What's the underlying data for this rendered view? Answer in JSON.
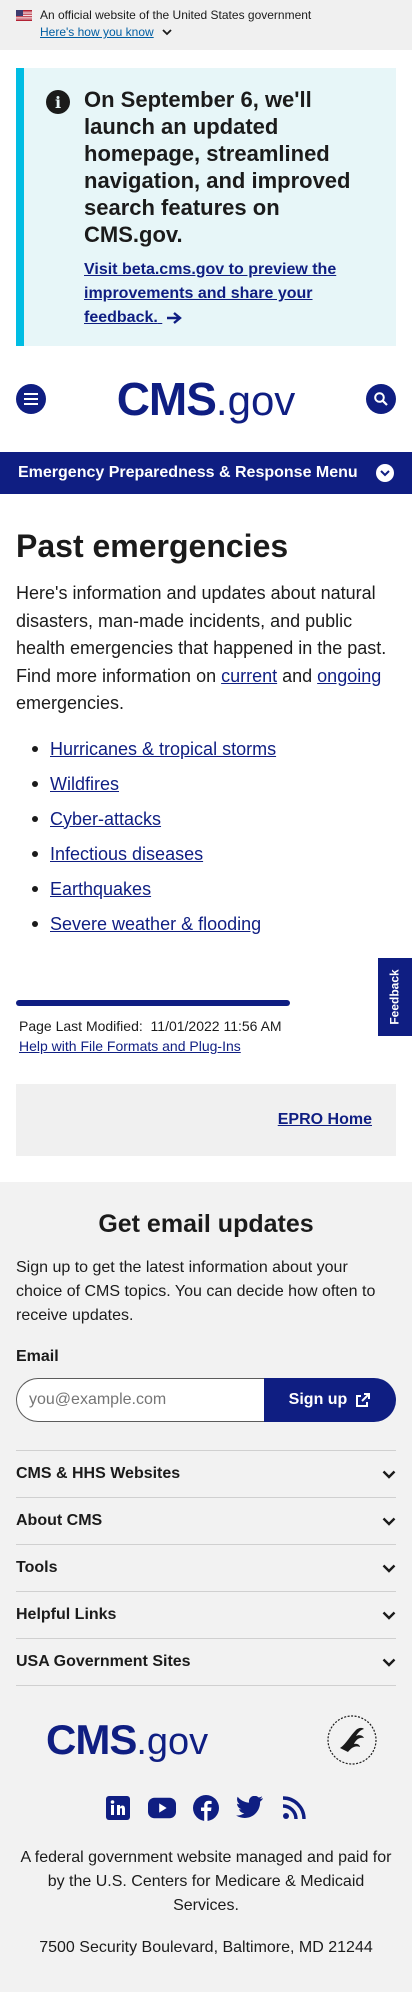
{
  "gov_banner": {
    "text": "An official website of the United States government",
    "link": "Here's how you know"
  },
  "alert": {
    "heading": "On September 6, we'll launch an updated homepage, streamlined navigation, and improved search features on CMS.gov.",
    "link_text": "Visit beta.cms.gov to preview the improvements and share your feedback."
  },
  "header": {
    "logo_bold": "CMS",
    "logo_rest": ".gov"
  },
  "menu": {
    "label": "Emergency Preparedness & Response Menu"
  },
  "main": {
    "title": "Past emergencies",
    "intro_prefix": "Here's information and updates about natural disasters, man-made incidents, and public health emergencies that happened in the past. Find more information on ",
    "intro_link1": "current",
    "intro_mid": " and ",
    "intro_link2": "ongoing",
    "intro_suffix": " emergencies.",
    "list": [
      "Hurricanes & tropical storms",
      "Wildfires",
      "Cyber-attacks",
      "Infectious diseases",
      "Earthquakes",
      "Severe weather & flooding"
    ]
  },
  "feedback": {
    "label": "Feedback"
  },
  "page_meta": {
    "modified_label": "Page Last Modified:",
    "modified_value": "11/01/2022 11:56 AM",
    "help_link": "Help with File Formats and Plug-Ins"
  },
  "epro": {
    "link": "EPRO Home"
  },
  "footer": {
    "signup_title": "Get email updates",
    "signup_desc": "Sign up to get the latest information about your choice of CMS topics. You can decide how often to receive updates.",
    "email_label": "Email",
    "email_placeholder": "you@example.com",
    "signup_button": "Sign up",
    "accordion": [
      "CMS & HHS Websites",
      "About CMS",
      "Tools",
      "Helpful Links",
      "USA Government Sites"
    ],
    "agency_text": "A federal government website managed and paid for by the U.S. Centers for Medicare & Medicaid Services.",
    "address": "7500 Security Boulevard, Baltimore, MD 21244"
  },
  "colors": {
    "primary": "#0f1e82",
    "alert_bg": "#e7f6f8",
    "alert_border": "#00bde3",
    "footer_bg": "#f2f2f2"
  },
  "icons": [
    "us-flag-icon",
    "chevron-down-icon",
    "info-icon",
    "arrow-right-icon",
    "menu-icon",
    "search-icon",
    "external-link-icon",
    "linkedin-icon",
    "youtube-icon",
    "facebook-icon",
    "twitter-icon",
    "rss-icon",
    "hhs-seal-icon"
  ]
}
